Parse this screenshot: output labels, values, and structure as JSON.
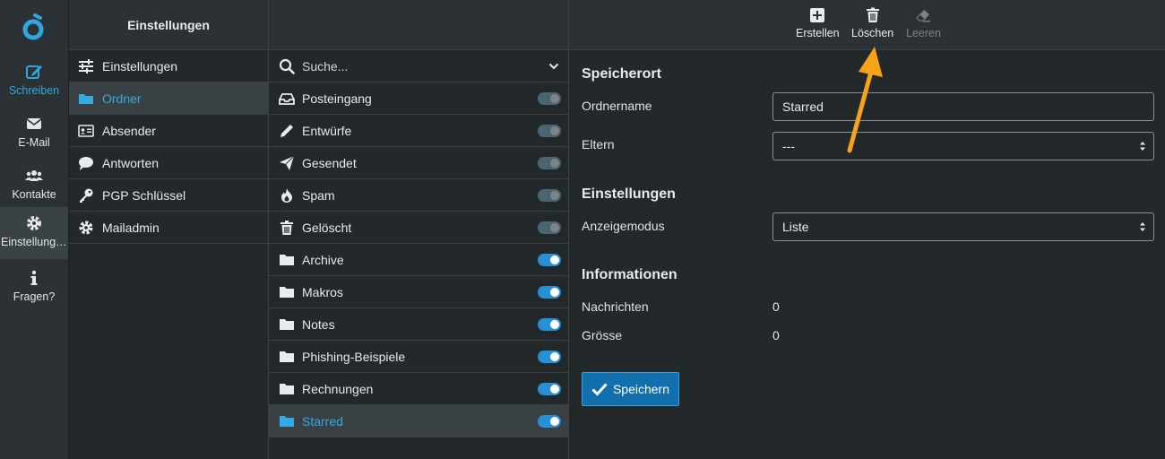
{
  "nav": {
    "items": [
      {
        "label": "Schreiben",
        "icon": "compose-icon"
      },
      {
        "label": "E-Mail",
        "icon": "envelope-icon"
      },
      {
        "label": "Kontakte",
        "icon": "users-icon"
      },
      {
        "label": "Einstellungen",
        "icon": "gear-icon"
      },
      {
        "label": "Fragen?",
        "icon": "info-icon"
      }
    ]
  },
  "settings": {
    "title": "Einstellungen",
    "items": [
      {
        "label": "Einstellungen",
        "icon": "sliders-icon"
      },
      {
        "label": "Ordner",
        "icon": "folder-icon"
      },
      {
        "label": "Absender",
        "icon": "id-card-icon"
      },
      {
        "label": "Antworten",
        "icon": "speech-bubble-icon"
      },
      {
        "label": "PGP Schlüssel",
        "icon": "key-icon"
      },
      {
        "label": "Mailadmin",
        "icon": "gear-icon"
      }
    ]
  },
  "folders": {
    "search_placeholder": "Suche...",
    "items": [
      {
        "label": "Posteingang",
        "icon": "inbox-icon",
        "subscribed": false
      },
      {
        "label": "Entwürfe",
        "icon": "pencil-icon",
        "subscribed": false
      },
      {
        "label": "Gesendet",
        "icon": "paper-plane-icon",
        "subscribed": false
      },
      {
        "label": "Spam",
        "icon": "fire-icon",
        "subscribed": false
      },
      {
        "label": "Gelöscht",
        "icon": "trash-icon",
        "subscribed": false
      },
      {
        "label": "Archive",
        "icon": "folder-icon",
        "subscribed": true
      },
      {
        "label": "Makros",
        "icon": "folder-icon",
        "subscribed": true
      },
      {
        "label": "Notes",
        "icon": "folder-icon",
        "subscribed": true
      },
      {
        "label": "Phishing-Beispiele",
        "icon": "folder-icon",
        "subscribed": true
      },
      {
        "label": "Rechnungen",
        "icon": "folder-icon",
        "subscribed": true
      },
      {
        "label": "Starred",
        "icon": "folder-icon",
        "subscribed": true
      }
    ]
  },
  "toolbar": {
    "create_label": "Erstellen",
    "delete_label": "Löschen",
    "empty_label": "Leeren"
  },
  "detail": {
    "location_title": "Speicherort",
    "folder_name_label": "Ordnername",
    "folder_name_value": "Starred",
    "parent_label": "Eltern",
    "parent_value": "---",
    "settings_title": "Einstellungen",
    "view_mode_label": "Anzeigemodus",
    "view_mode_value": "Liste",
    "info_title": "Informationen",
    "messages_label": "Nachrichten",
    "messages_value": "0",
    "size_label": "Grösse",
    "size_value": "0",
    "save_label": "Speichern"
  },
  "colors": {
    "accent": "#36aae3",
    "annotation_arrow": "#f7a21b",
    "save_button": "#116fae"
  }
}
